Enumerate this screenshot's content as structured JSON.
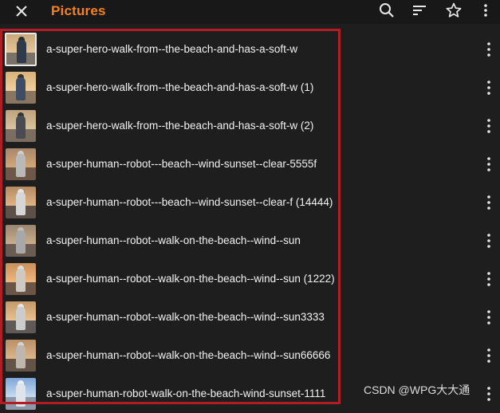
{
  "header": {
    "title": "Pictures",
    "accent_color": "#f5821f",
    "icons": [
      "close-icon",
      "search-icon",
      "sort-icon",
      "star-icon",
      "more-vertical-icon"
    ]
  },
  "files": [
    {
      "name": "a-super-hero-walk-from--the-beach-and-has-a-soft-w"
    },
    {
      "name": "a-super-hero-walk-from--the-beach-and-has-a-soft-w (1)"
    },
    {
      "name": "a-super-hero-walk-from--the-beach-and-has-a-soft-w (2)"
    },
    {
      "name": "a-super-human--robot---beach--wind-sunset--clear-5555f"
    },
    {
      "name": "a-super-human--robot---beach--wind-sunset--clear-f (14444)"
    },
    {
      "name": "a-super-human--robot--walk-on-the-beach--wind--sun"
    },
    {
      "name": "a-super-human--robot--walk-on-the-beach--wind--sun (1222)"
    },
    {
      "name": "a-super-human--robot--walk-on-the-beach--wind--sun3333"
    },
    {
      "name": "a-super-human--robot--walk-on-the-beach--wind--sun66666"
    },
    {
      "name": "a-super-human-robot-walk-on-the-beach-wind-sunset-1111"
    }
  ],
  "highlight_color": "#b01d22",
  "watermark": "CSDN @WPG大大通"
}
